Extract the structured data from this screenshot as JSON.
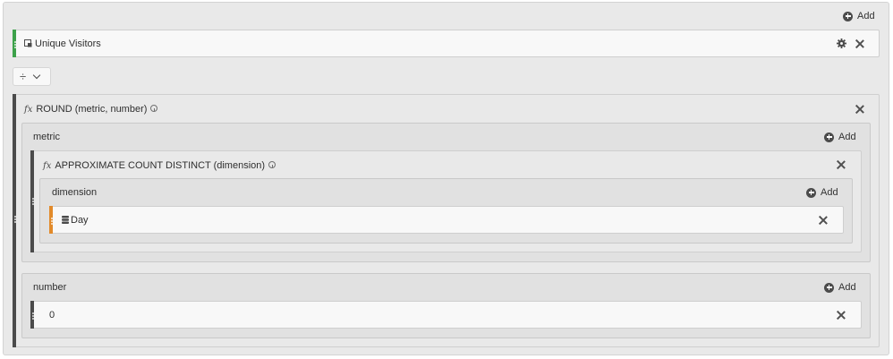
{
  "toolbar": {
    "add_label": "Add"
  },
  "metric_card": {
    "label": "Unique Visitors",
    "accent": "#3da14a"
  },
  "operator": {
    "symbol": "÷"
  },
  "round_fn": {
    "fx": "fx",
    "label": "ROUND (metric, number)",
    "accent": "#4b4b4b"
  },
  "metric_arg": {
    "label": "metric",
    "add_label": "Add"
  },
  "approx_fn": {
    "fx": "fx",
    "label": "APPROXIMATE COUNT DISTINCT (dimension)"
  },
  "dimension_arg": {
    "label": "dimension",
    "add_label": "Add"
  },
  "day_card": {
    "label": "Day",
    "accent": "#e28a2a"
  },
  "number_arg": {
    "label": "number",
    "add_label": "Add"
  },
  "number_value": {
    "value": "0"
  }
}
